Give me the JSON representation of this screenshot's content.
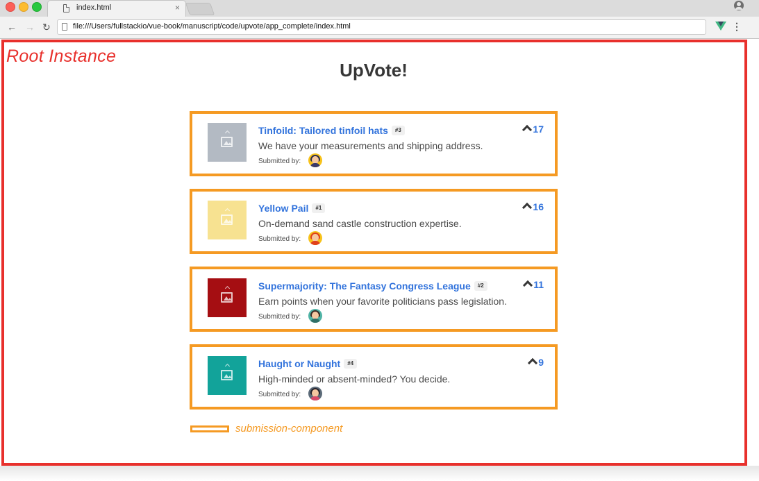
{
  "browser": {
    "tab_title": "index.html",
    "tab_close": "×",
    "url": "file:///Users/fullstackio/vue-book/manuscript/code/upvote/app_complete/index.html",
    "icons": [
      "back-arrow-icon",
      "forward-arrow-icon",
      "reload-icon",
      "page-icon",
      "vue-devtools-icon",
      "menu-icon",
      "profile-icon"
    ]
  },
  "annotations": {
    "root_label": "Root Instance",
    "root_color": "#e8302c",
    "component_label": "submission-component",
    "component_color": "#f59a23"
  },
  "page": {
    "title": "UpVote!"
  },
  "submissions": [
    {
      "title": "Tinfoild: Tailored tinfoil hats",
      "rank": "#3",
      "description": "We have your measurements and shipping address.",
      "submitted_by": "Submitted by:",
      "votes": "17",
      "thumb_color": "#b3bac3",
      "avatar": "avatar-woman-dark-hair"
    },
    {
      "title": "Yellow Pail",
      "rank": "#1",
      "description": "On-demand sand castle construction expertise.",
      "submitted_by": "Submitted by:",
      "votes": "16",
      "thumb_color": "#f7e291",
      "avatar": "avatar-man-red-hair"
    },
    {
      "title": "Supermajority: The Fantasy Congress League",
      "rank": "#2",
      "description": "Earn points when your favorite politicians pass legislation.",
      "submitted_by": "Submitted by:",
      "votes": "11",
      "thumb_color": "#a50e12",
      "avatar": "avatar-woman-teal"
    },
    {
      "title": "Haught or Naught",
      "rank": "#4",
      "description": "High-minded or absent-minded? You decide.",
      "submitted_by": "Submitted by:",
      "votes": "9",
      "thumb_color": "#12a39a",
      "avatar": "avatar-woman-long-hair"
    }
  ]
}
